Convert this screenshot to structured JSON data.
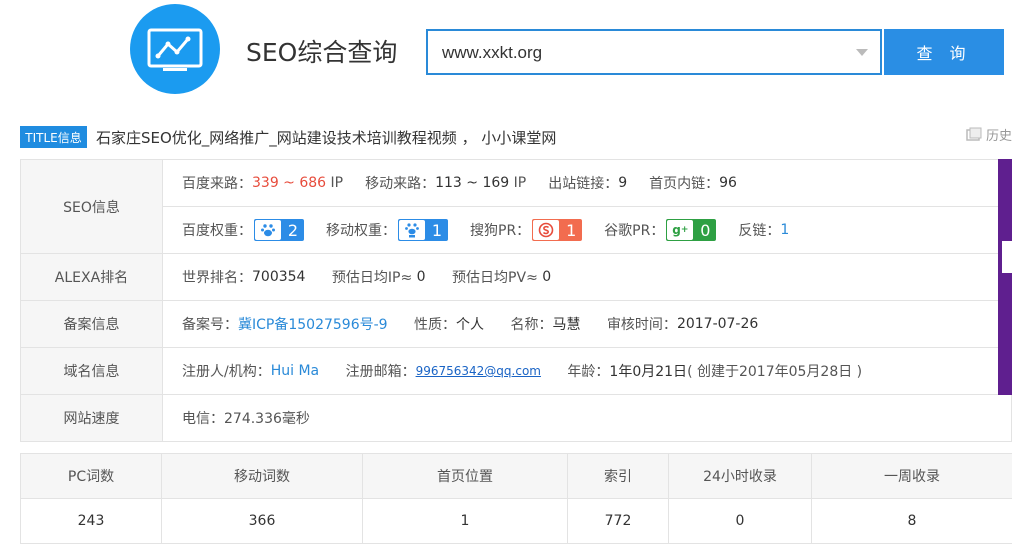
{
  "header": {
    "logo_icon": "chart-monitor-icon",
    "app_title": "SEO综合查询",
    "search": {
      "value": "www.xxkt.org",
      "placeholder": ""
    },
    "search_button": "查 询"
  },
  "title_row": {
    "badge": "TITLE信息",
    "title": "石家庄SEO优化_网络推广_网站建设技术培训教程视频 ， 小小课堂网",
    "history_label": "历史"
  },
  "seo_info": {
    "label": "SEO信息",
    "row1": {
      "baidu_source_label": "百度来路：",
      "baidu_source_value": "339 ~ 686",
      "baidu_source_unit": "IP",
      "mobile_source_label": "移动来路：",
      "mobile_source_value": "113 ~ 169",
      "mobile_source_unit": "IP",
      "outbound_label": "出站链接：",
      "outbound_value": "9",
      "internal_label": "首页内链：",
      "internal_value": "96"
    },
    "row2": {
      "baidu_weight_label": "百度权重：",
      "baidu_weight_value": "2",
      "mobile_weight_label": "移动权重：",
      "mobile_weight_value": "1",
      "sogou_label": "搜狗PR：",
      "sogou_value": "1",
      "google_label": "谷歌PR：",
      "google_value": "0",
      "backlink_label": "反链：",
      "backlink_value": "1"
    }
  },
  "alexa": {
    "label": "ALEXA排名",
    "world_rank_label": "世界排名：",
    "world_rank_value": "700354",
    "daily_ip_label": "预估日均IP≈",
    "daily_ip_value": "0",
    "daily_pv_label": "预估日均PV≈",
    "daily_pv_value": "0"
  },
  "icp": {
    "label": "备案信息",
    "number_label": "备案号：",
    "number_value": "冀ICP备15027596号-9",
    "nature_label": "性质：",
    "nature_value": "个人",
    "name_label": "名称：",
    "name_value": "马慧",
    "date_label": "审核时间：",
    "date_value": "2017-07-26"
  },
  "domain": {
    "label": "域名信息",
    "registrant_label": "注册人/机构：",
    "registrant_value": "Hui Ma",
    "email_label": "注册邮箱：",
    "email_value": "996756342@qq.com",
    "age_label": "年龄：",
    "age_value": "1年0月21日",
    "created_note": "( 创建于2017年05月28日 )"
  },
  "speed": {
    "label": "网站速度",
    "value": "电信：274.336毫秒"
  },
  "keywords": {
    "headers": [
      "PC词数",
      "移动词数",
      "首页位置",
      "索引",
      "24小时收录",
      "一周收录"
    ],
    "values": [
      "243",
      "366",
      "1",
      "772",
      "0",
      "8"
    ]
  },
  "colors": {
    "accent": "#2a8ee4",
    "logo": "#1b9bf0",
    "highlight_red": "#e74c3c",
    "sogou": "#f26c4f",
    "google": "#2ea043",
    "ad_strip": "#5f1f8f"
  }
}
